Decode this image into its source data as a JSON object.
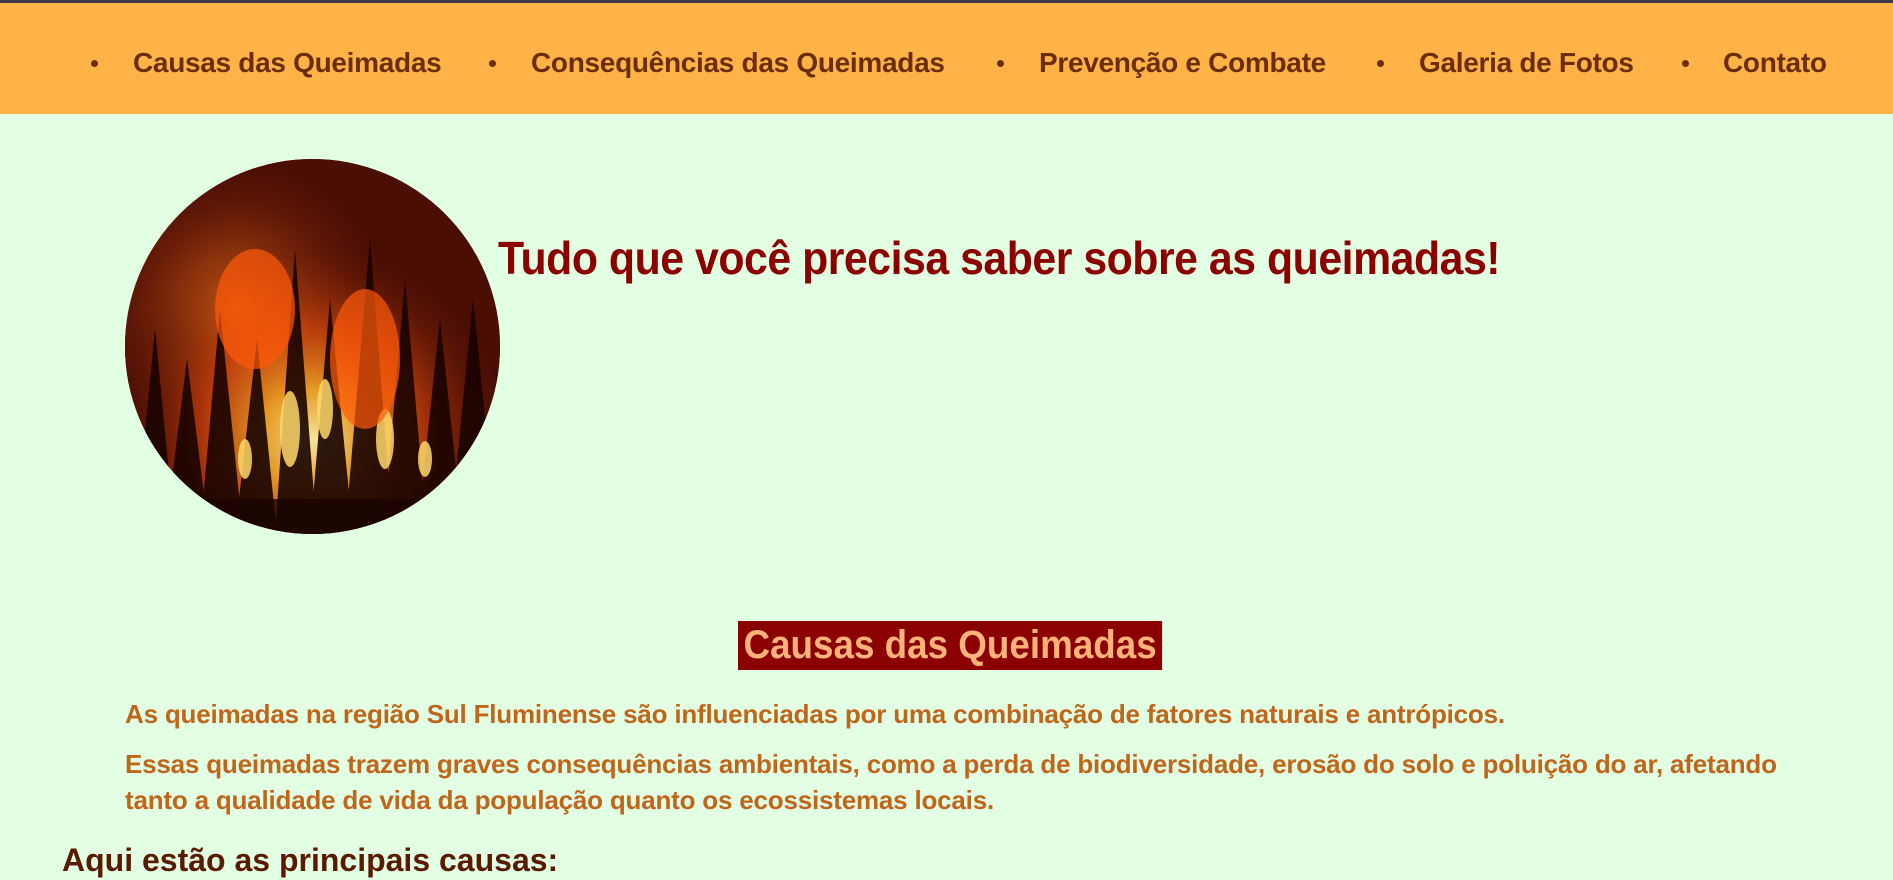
{
  "colors": {
    "page_background": "#e3ffe3",
    "nav_background": "#ffb347",
    "nav_text": "#6b2d0a",
    "title_text": "#8b0000",
    "section_title_background": "#8b0000",
    "section_title_text": "#ffb37a",
    "paragraph_text": "#c0661c"
  },
  "nav": {
    "items": [
      {
        "label": "Causas das Queimadas"
      },
      {
        "label": "Consequências das Queimadas"
      },
      {
        "label": "Prevenção e Combate"
      },
      {
        "label": "Galeria de Fotos"
      },
      {
        "label": "Contato"
      }
    ]
  },
  "hero": {
    "image_icon": "forest-fire-image",
    "title": "Tudo que você precisa saber sobre as queimadas!"
  },
  "section": {
    "title": "Causas das Queimadas",
    "paragraphs": [
      "As queimadas na região Sul Fluminense são influenciadas por uma combinação de fatores naturais e antrópicos.",
      "Essas queimadas trazem graves consequências ambientais, como a perda de biodiversidade, erosão do solo e poluição do ar, afetando tanto a qualidade de vida da população quanto os ecossistemas locais."
    ],
    "subheading": "Aqui estão as principais causas:"
  }
}
